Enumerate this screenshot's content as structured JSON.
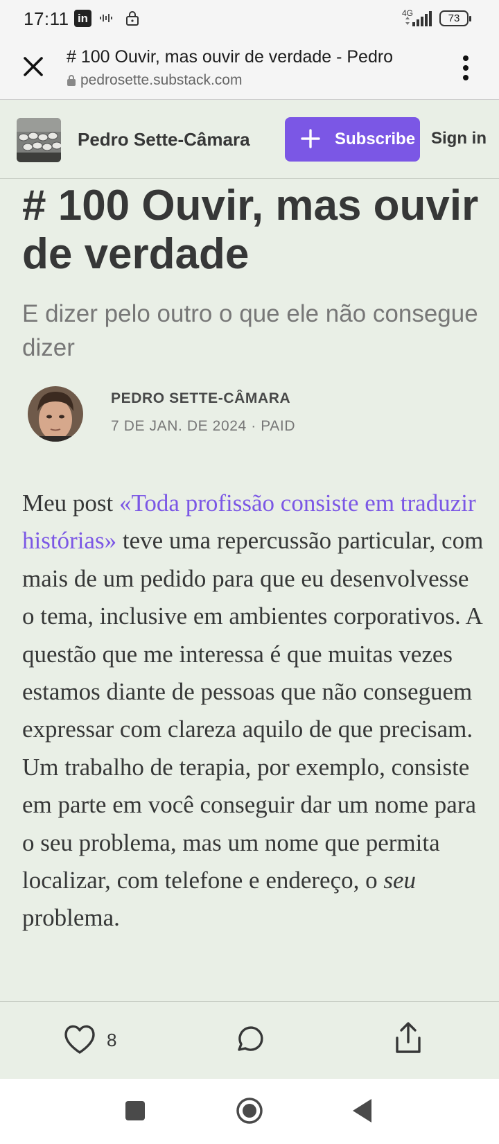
{
  "status_bar": {
    "time": "17:11",
    "network": "4G",
    "battery": "73",
    "icons": [
      "linkedin-icon",
      "sound-wave-icon",
      "lock-icon",
      "signal-icon",
      "battery-icon"
    ]
  },
  "browser": {
    "page_title": "# 100 Ouvir, mas ouvir de verdade - Pedro",
    "url": "pedrosette.substack.com",
    "icons": [
      "close-icon",
      "url-lock-icon",
      "more-vert-icon"
    ]
  },
  "publication": {
    "name": "Pedro Sette-Câmara",
    "subscribe_label": "Subscribe",
    "signin_label": "Sign in"
  },
  "post": {
    "title": "# 100 Ouvir, mas ouvir de verdade",
    "subtitle": "E dizer pelo outro o que ele não consegue dizer",
    "author": "PEDRO SETTE-CÂMARA",
    "meta": "7 DE JAN. DE 2024 · PAID",
    "body_intro": "Meu post ",
    "body_link": "«Toda profissão consiste em traduzir histórias»",
    "body_main": " teve uma repercussão particular, com mais de um pedido para que eu desenvolvesse o tema, inclusive em ambientes corporativos. A questão que me interessa é que muitas vezes estamos diante de pessoas que não conseguem expressar com clareza aquilo de que precisam. Um trabalho de terapia, por exemplo, consiste em parte em você conseguir dar um nome para o seu problema, mas um nome que permita localizar, com telefone e endereço, o ",
    "body_em": "seu",
    "body_end": " problema."
  },
  "actions": {
    "like_count": "8",
    "icons": [
      "heart-icon",
      "comment-icon",
      "share-icon"
    ]
  },
  "nav": {
    "icons": [
      "recent-apps-icon",
      "home-icon",
      "back-icon"
    ]
  },
  "colors": {
    "accent": "#7b57e5",
    "page_bg": "#e9efe6",
    "text": "#363737",
    "muted": "#777777"
  }
}
